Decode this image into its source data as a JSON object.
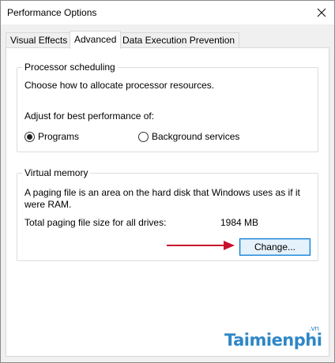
{
  "window": {
    "title": "Performance Options",
    "close_icon": "close-icon"
  },
  "tabs": [
    {
      "label": "Visual Effects",
      "active": false
    },
    {
      "label": "Advanced",
      "active": true
    },
    {
      "label": "Data Execution Prevention",
      "active": false
    }
  ],
  "processor": {
    "title": "Processor scheduling",
    "description": "Choose how to allocate processor resources.",
    "adjust_label": "Adjust for best performance of:",
    "options": [
      {
        "label": "Programs",
        "selected": true
      },
      {
        "label": "Background services",
        "selected": false
      }
    ]
  },
  "virtual_memory": {
    "title": "Virtual memory",
    "description_line1": "A paging file is an area on the hard disk that Windows uses as if it",
    "description_line2": "were RAM.",
    "total_label": "Total paging file size for all drives:",
    "total_value": "1984 MB",
    "change_button": "Change..."
  },
  "colors": {
    "arrow": "#c8102e",
    "button_border": "#0078d7",
    "watermark": "#2f87c6"
  },
  "watermark": {
    "text": "Taimienphi",
    "suffix": ".vn"
  }
}
